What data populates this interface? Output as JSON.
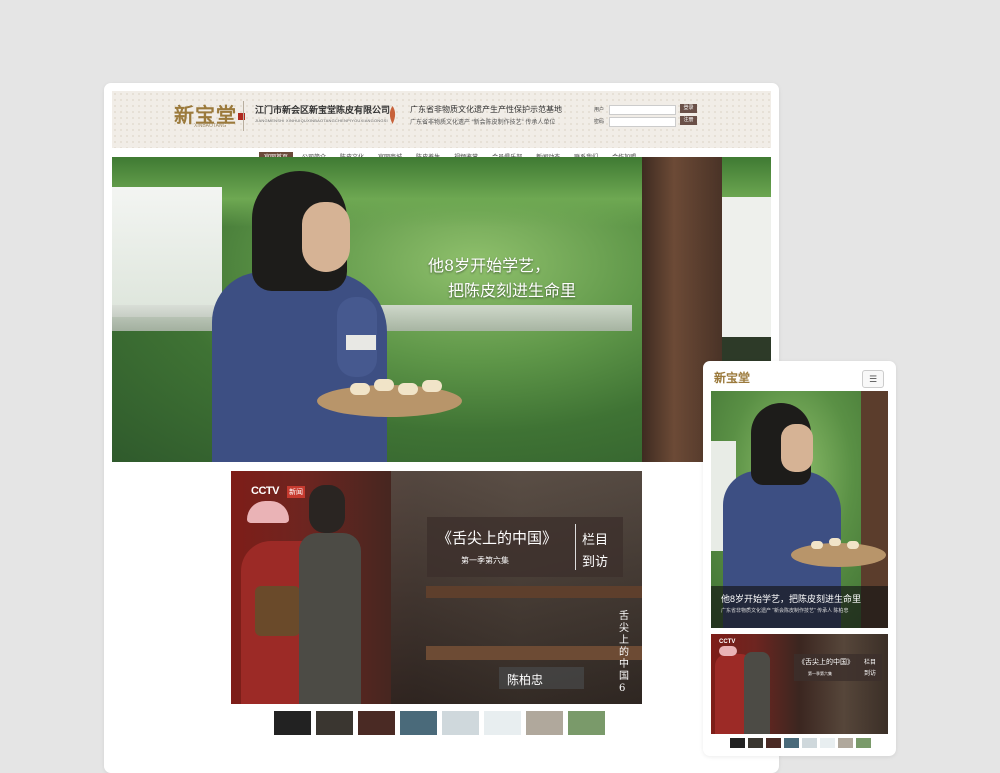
{
  "header": {
    "logo_text": "新宝堂",
    "logo_sub": "XINBAOTANG",
    "company_name": "江门市新会区新宝堂陈皮有限公司",
    "company_name_en": "JIANGMENSHI XINHUIQUXINBAOTANGCHENPIYOUXIANGONGSI",
    "slogan_line1": "广东省非物质文化遗产生产性保护示范基地",
    "slogan_line2": "广东省非物质文化遗产 “新会陈皮制作技艺” 传承人单位"
  },
  "login": {
    "user_label": "用户",
    "pass_label": "密码",
    "login_button": "登录",
    "register_button": "注册"
  },
  "nav": [
    {
      "label": "官网首页",
      "active": true
    },
    {
      "label": "公司简介",
      "active": false
    },
    {
      "label": "陈皮文化",
      "active": false
    },
    {
      "label": "官网商城",
      "active": false
    },
    {
      "label": "陈皮养生",
      "active": false
    },
    {
      "label": "视频鉴赏",
      "active": false
    },
    {
      "label": "会员俱乐部",
      "active": false
    },
    {
      "label": "新闻动态",
      "active": false
    },
    {
      "label": "联系我们",
      "active": false
    },
    {
      "label": "合作加盟",
      "active": false
    }
  ],
  "banner": {
    "line1": "他8岁开始学艺，",
    "line2": "把陈皮刻进生命里"
  },
  "video": {
    "channel": "CCTV",
    "channel_sub": "新闻",
    "program_title": "《舌尖上的中国》",
    "episode": "第一季第六集",
    "tag_line1": "栏目",
    "tag_line2": "到访",
    "vertical_text": "舌尖上的中国6",
    "person_name": "陈柏忠"
  },
  "thumbnails": [
    "#222",
    "#3a3630",
    "#4a2a24",
    "#4a6a7a",
    "#cfd8dc",
    "#e8eef0",
    "#b0a89c",
    "#7a9a6a"
  ],
  "mobile": {
    "logo_text": "新宝堂",
    "menu_icon": "hamburger-icon",
    "caption_line1": "他8岁开始学艺，把陈皮刻进生命里",
    "caption_line2": "广东省非物质文化遗产 “新会陈皮制作技艺” 传承人 陈柏忠",
    "channel": "CCTV",
    "program_title": "《舌尖上的中国》",
    "episode": "第一季第六集",
    "tag_line1": "栏目",
    "tag_line2": "到访"
  },
  "colors": {
    "accent_brown": "#6b4a3a",
    "logo_gold": "#9b7a3c",
    "seal_red": "#b02a20"
  }
}
